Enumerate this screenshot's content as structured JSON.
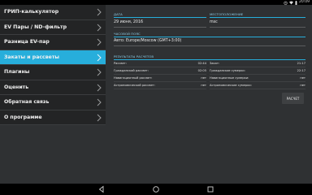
{
  "status_bar": {
    "time": "20:09"
  },
  "sidebar": {
    "items": [
      {
        "label": "ГРИП-калькулятор",
        "active": false
      },
      {
        "label": "EV Пары / ND-фильтр",
        "active": false
      },
      {
        "label": "Разница EV-пар",
        "active": false
      },
      {
        "label": "Закаты и рассветы",
        "active": true
      },
      {
        "label": "Плагины",
        "active": false
      },
      {
        "label": "Оценить",
        "active": false
      },
      {
        "label": "Обратная связь",
        "active": false
      },
      {
        "label": "О программе",
        "active": false
      }
    ]
  },
  "form": {
    "date_title": "ДАТА",
    "date_value": "29 июня, 2016",
    "location_title": "МЕСТОПОЛОЖЕНИЕ",
    "location_value": "msc",
    "timezone_title": "ЧАСОВОЙ ПОЯС",
    "timezone_value": "Авто: Europe/Moscow (GMT+3:00)"
  },
  "results": {
    "title": "РЕЗУЛЬТАТЫ РАСЧЕТОВ",
    "left": [
      {
        "label": "Рассвет:",
        "value": "02:44"
      },
      {
        "label": "Гражданский рассвет:",
        "value": "02:05"
      },
      {
        "label": "Навигационный рассвет:",
        "value": "нет"
      },
      {
        "label": "Астрономический рассвет:",
        "value": "нет"
      }
    ],
    "right": [
      {
        "label": "Закат:",
        "value": "21:17"
      },
      {
        "label": "Гражданские сумерки:",
        "value": "22:17"
      },
      {
        "label": "Навигационные сумерки:",
        "value": "нет"
      },
      {
        "label": "Астрономические сумерки:",
        "value": "нет"
      }
    ]
  },
  "calc_button": {
    "label": "РАСЧЕТ"
  },
  "colors": {
    "accent": "#27aedb",
    "background": "#2f3133",
    "sidebar": "#232425"
  }
}
